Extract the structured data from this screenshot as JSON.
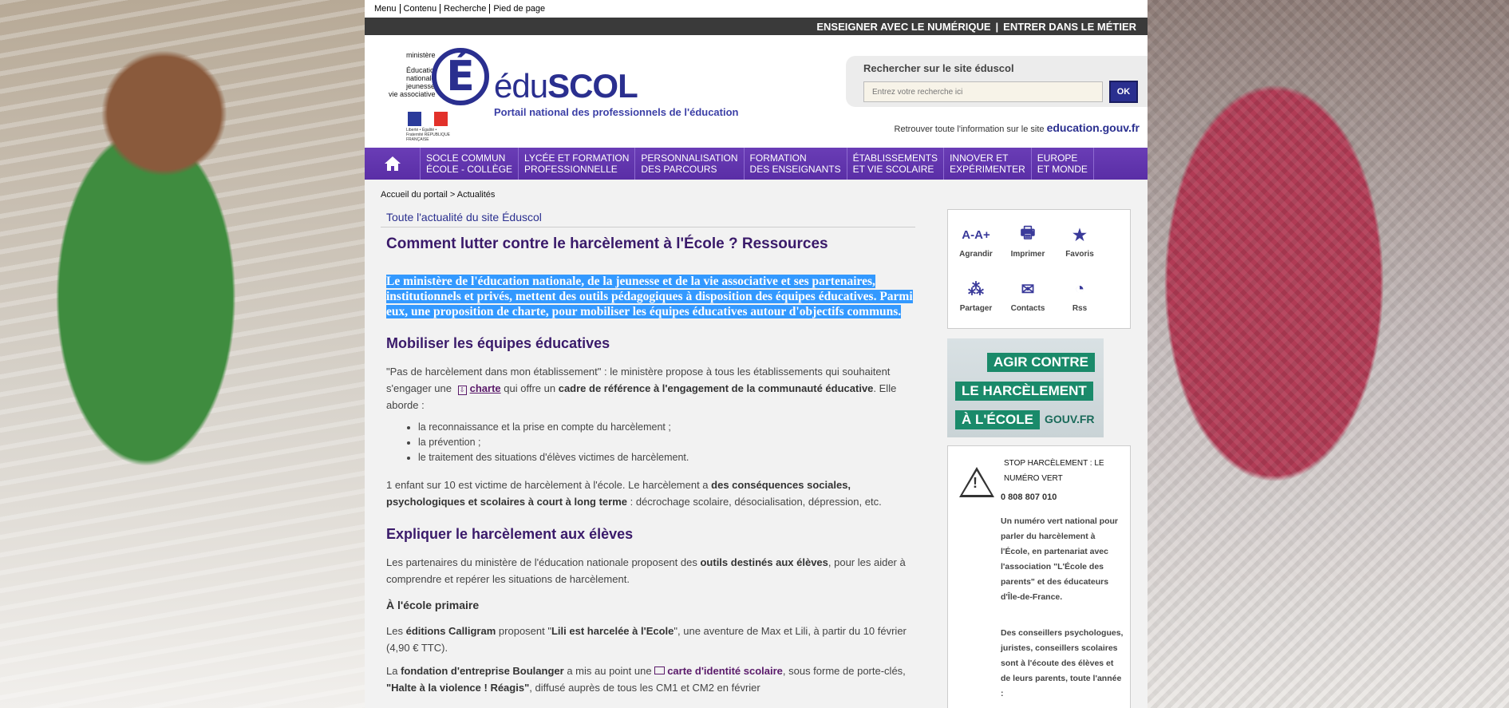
{
  "skip_links": [
    "Menu",
    "Contenu",
    "Recherche",
    "Pied de page"
  ],
  "topbar": {
    "link1": "ENSEIGNER AVEC LE NUMÉRIQUE",
    "separator": "|",
    "link2": "ENTRER DANS LE MÉTIER"
  },
  "header": {
    "ministry_lines": [
      "ministère",
      "Éducation",
      "nationale",
      "jeunesse",
      "vie associative"
    ],
    "flag_caption": "Liberté • Égalité • Fraternité RÉPUBLIQUE FRANÇAISE",
    "brand_letter": "É",
    "brand_light": "édu",
    "brand_bold": "SCOL",
    "tagline": "Portail national des professionnels de l'éducation",
    "search_label": "Rechercher sur le site éduscol",
    "search_placeholder": "Entrez votre recherche ici",
    "search_button": "OK",
    "edu_text": "Retrouver toute l'information sur le site",
    "edu_site": "education.gouv.fr"
  },
  "nav": [
    {
      "l1": "Socle commun",
      "l2": "École - collège"
    },
    {
      "l1": "Lycée et formation",
      "l2": "professionnelle"
    },
    {
      "l1": "Personnalisation",
      "l2": "des parcours"
    },
    {
      "l1": "Formation",
      "l2": "des enseignants"
    },
    {
      "l1": "Établissements",
      "l2": "et vie scolaire"
    },
    {
      "l1": "Innover et",
      "l2": "expérimenter"
    },
    {
      "l1": "Europe",
      "l2": "et monde"
    }
  ],
  "breadcrumb": {
    "home": "Accueil du portail",
    "sep": ">",
    "current": "Actualités"
  },
  "article": {
    "kicker": "Toute l'actualité du site Éduscol",
    "title": "Comment lutter contre le harcèlement à l'École ? Ressources",
    "lead": "Le ministère de l'éducation nationale, de la jeunesse et de la vie associative et ses partenaires, institutionnels et privés, mettent des outils pédagogiques à disposition des équipes éducatives. Parmi eux, une proposition de charte, pour mobiliser les équipes éducatives autour d'objectifs communs.",
    "h2_1": "Mobiliser les équipes éducatives",
    "p1_a": "\"Pas de harcèlement dans mon établissement\" : le ministère propose à tous les établissements qui souhaitent s'engager une",
    "p1_link": "charte",
    "p1_b": "qui offre un",
    "p1_bold": "cadre de référence à l'engagement de la communauté éducative",
    "p1_c": ". Elle aborde :",
    "bullets": [
      "la reconnaissance et la prise en compte du harcèlement ;",
      "la prévention ;",
      "le traitement des situations d'élèves victimes de harcèlement."
    ],
    "p2_a": "1 enfant sur 10 est victime de harcèlement à l'école. Le harcèlement a",
    "p2_bold": "des conséquences sociales, psychologiques et scolaires à court à long terme",
    "p2_b": ": décrochage scolaire, désocialisation, dépression, etc.",
    "h2_2": "Expliquer le harcèlement aux élèves",
    "p3_a": "Les partenaires du ministère de l'éducation nationale proposent des",
    "p3_bold": "outils destinés aux élèves",
    "p3_b": ", pour les aider à comprendre et repérer les situations de harcèlement.",
    "h3_1": "À l'école primaire",
    "p4_a": "Les",
    "p4_bold1": "éditions Calligram",
    "p4_b": "proposent \"",
    "p4_bold2": "Lili est harcelée à l'Ecole",
    "p4_c": "\", une aventure de Max et Lili, à partir du 10 février (4,90 € TTC).",
    "p5_a": "La",
    "p5_bold": "fondation d'entreprise Boulanger",
    "p5_b": "a mis au point une",
    "p5_link": "carte d'identité scolaire",
    "p5_c": ", sous forme de porte-clés,",
    "p5_bold2": "\"Halte à la violence ! Réagis\"",
    "p5_d": ", diffusé auprès de tous les CM1 et CM2 en février"
  },
  "tools": [
    {
      "icon": "text-size-icon",
      "glyph": "A-A+",
      "label": "Agrandir"
    },
    {
      "icon": "printer-icon",
      "glyph": "🖶",
      "label": "Imprimer"
    },
    {
      "icon": "star-icon",
      "glyph": "★",
      "label": "Favoris"
    },
    {
      "icon": "share-icon",
      "glyph": "⁂",
      "label": "Partager"
    },
    {
      "icon": "envelope-icon",
      "glyph": "✉",
      "label": "Contacts"
    },
    {
      "icon": "rss-icon",
      "glyph": "◔",
      "label": "Rss"
    }
  ],
  "campaign": {
    "line1": "AGIR CONTRE",
    "line2": "LE HARCÈLEMENT",
    "line3": "À L'ÉCOLE",
    "domain": "GOUV.FR"
  },
  "stop": {
    "title": "STOP HARCÈLEMENT : LE NUMÉRO VERT",
    "number": "0 808 807 010",
    "text1": "Un numéro vert national pour parler du harcèlement à l'École, en partenariat avec l'association \"L'École des parents\" et des éducateurs d'Île-de-France.",
    "text2": "Des conseillers psychologues, juristes, conseillers scolaires sont à l'écoute des élèves et de leurs parents, toute l'année :"
  },
  "colors": {
    "brand": "#2a2f8f",
    "nav": "#5a2ea6",
    "selection": "#3399ff",
    "campaign_green": "#1a8a6a"
  }
}
